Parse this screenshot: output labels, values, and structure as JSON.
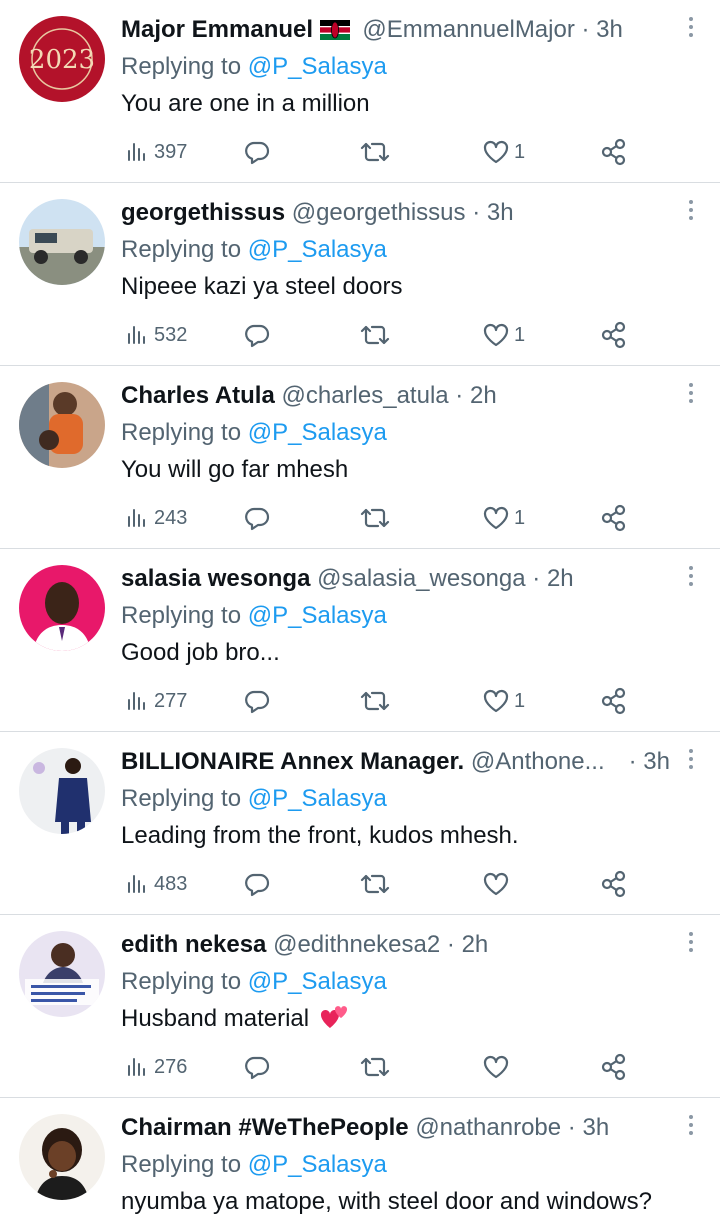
{
  "reply_prefix": "Replying to",
  "tweets": [
    {
      "name": "Major Emmanuel",
      "has_flag": true,
      "handle": "@EmmannuelMajor",
      "sep": "·",
      "time": "3h",
      "mention": "@P_Salasya",
      "text": "You are one in a million",
      "views": "397",
      "likes": "1"
    },
    {
      "name": "georgethissus",
      "handle": "@georgethissus",
      "sep": "·",
      "time": "3h",
      "mention": "@P_Salasya",
      "text": "Nipeee kazi ya steel doors",
      "views": "532",
      "likes": "1"
    },
    {
      "name": "Charles Atula",
      "handle": "@charles_atula",
      "sep": "·",
      "time": "2h",
      "mention": "@P_Salasya",
      "text": "You will go far mhesh",
      "views": "243",
      "likes": "1"
    },
    {
      "name": "salasia wesonga",
      "handle": "@salasia_wesonga",
      "sep": "·",
      "time": "2h",
      "mention": "@P_Salasya",
      "text": "Good job bro...",
      "views": "277",
      "likes": "1"
    },
    {
      "name": "BILLIONAIRE Annex Manager.",
      "handle": "@Anthone...",
      "sep": "·",
      "time": "3h",
      "mention": "@P_Salasya",
      "text": "Leading from the front, kudos mhesh.",
      "views": "483",
      "likes": ""
    },
    {
      "name": "edith nekesa",
      "handle": "@edithnekesa2",
      "sep": "·",
      "time": "2h",
      "mention": "@P_Salasya",
      "text": "Husband material",
      "has_heart_emoji": true,
      "views": "276",
      "likes": ""
    },
    {
      "name": "Chairman #WeThePeople",
      "handle": "@nathanrobe",
      "sep": "·",
      "time": "3h",
      "mention": "@P_Salasya",
      "text": "nyumba ya matope, with steel door and windows?"
    }
  ],
  "colors": {
    "text": "#0f1419",
    "secondary": "#536471",
    "link": "#1d9bf0",
    "divider": "#d9dde1"
  },
  "icons": [
    "views-icon",
    "reply-icon",
    "retweet-icon",
    "like-icon",
    "share-icon",
    "more-icon"
  ]
}
